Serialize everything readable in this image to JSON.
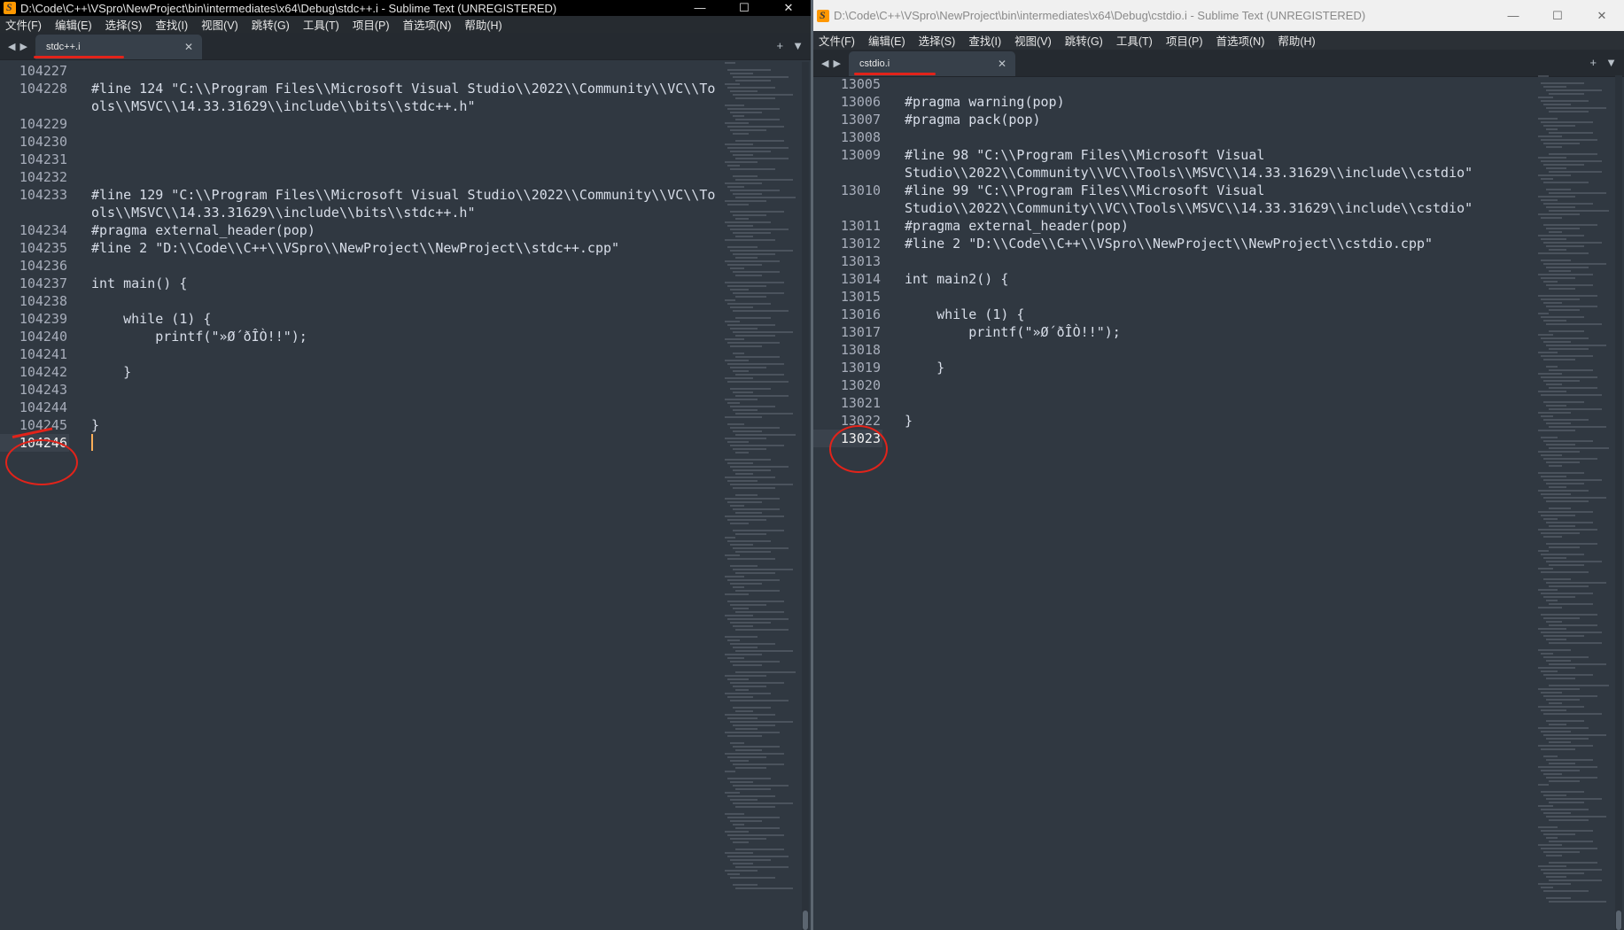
{
  "left": {
    "title": "D:\\Code\\C++\\VSpro\\NewProject\\bin\\intermediates\\x64\\Debug\\stdc++.i - Sublime Text (UNREGISTERED)",
    "menu": [
      "文件(F)",
      "编辑(E)",
      "选择(S)",
      "查找(I)",
      "视图(V)",
      "跳转(G)",
      "工具(T)",
      "项目(P)",
      "首选项(N)",
      "帮助(H)"
    ],
    "tab_label": "stdc++.i",
    "lines": [
      {
        "n": "104227",
        "t": "",
        "tall": false
      },
      {
        "n": "104228",
        "t": "#line 124 \"C:\\\\Program Files\\\\Microsoft Visual Studio\\\\2022\\\\Community\\\\VC\\\\To\nols\\\\MSVC\\\\14.33.31629\\\\include\\\\bits\\\\stdc++.h\"",
        "tall": true
      },
      {
        "n": "104229",
        "t": "",
        "tall": false
      },
      {
        "n": "104230",
        "t": "",
        "tall": false
      },
      {
        "n": "104231",
        "t": "",
        "tall": false
      },
      {
        "n": "104232",
        "t": "",
        "tall": false
      },
      {
        "n": "104233",
        "t": "#line 129 \"C:\\\\Program Files\\\\Microsoft Visual Studio\\\\2022\\\\Community\\\\VC\\\\To\nols\\\\MSVC\\\\14.33.31629\\\\include\\\\bits\\\\stdc++.h\"",
        "tall": true
      },
      {
        "n": "104234",
        "t": "#pragma external_header(pop)",
        "tall": false
      },
      {
        "n": "104235",
        "t": "#line 2 \"D:\\\\Code\\\\C++\\\\VSpro\\\\NewProject\\\\NewProject\\\\stdc++.cpp\"",
        "tall": false
      },
      {
        "n": "104236",
        "t": "",
        "tall": false
      },
      {
        "n": "104237",
        "t": "int main() {",
        "tall": false
      },
      {
        "n": "104238",
        "t": "",
        "tall": false
      },
      {
        "n": "104239",
        "t": "    while (1) {",
        "tall": false
      },
      {
        "n": "104240",
        "t": "        printf(\"»Ø´ðÎÒ!!\");",
        "tall": false
      },
      {
        "n": "104241",
        "t": "",
        "tall": false
      },
      {
        "n": "104242",
        "t": "    }",
        "tall": false
      },
      {
        "n": "104243",
        "t": "",
        "tall": false
      },
      {
        "n": "104244",
        "t": "",
        "tall": false
      },
      {
        "n": "104245",
        "t": "}",
        "tall": false
      },
      {
        "n": "104246",
        "t": "",
        "tall": false
      }
    ]
  },
  "right": {
    "title": "D:\\Code\\C++\\VSpro\\NewProject\\bin\\intermediates\\x64\\Debug\\cstdio.i - Sublime Text (UNREGISTERED)",
    "menu": [
      "文件(F)",
      "编辑(E)",
      "选择(S)",
      "查找(I)",
      "视图(V)",
      "跳转(G)",
      "工具(T)",
      "项目(P)",
      "首选项(N)",
      "帮助(H)"
    ],
    "tab_label": "cstdio.i",
    "lines": [
      {
        "n": "13005",
        "t": "",
        "tall": false
      },
      {
        "n": "13006",
        "t": "#pragma warning(pop)",
        "tall": false
      },
      {
        "n": "13007",
        "t": "#pragma pack(pop)",
        "tall": false
      },
      {
        "n": "13008",
        "t": "",
        "tall": false
      },
      {
        "n": "13009",
        "t": "#line 98 \"C:\\\\Program Files\\\\Microsoft Visual\nStudio\\\\2022\\\\Community\\\\VC\\\\Tools\\\\MSVC\\\\14.33.31629\\\\include\\\\cstdio\"",
        "tall": true
      },
      {
        "n": "13010",
        "t": "#line 99 \"C:\\\\Program Files\\\\Microsoft Visual\nStudio\\\\2022\\\\Community\\\\VC\\\\Tools\\\\MSVC\\\\14.33.31629\\\\include\\\\cstdio\"",
        "tall": true
      },
      {
        "n": "13011",
        "t": "#pragma external_header(pop)",
        "tall": false
      },
      {
        "n": "13012",
        "t": "#line 2 \"D:\\\\Code\\\\C++\\\\VSpro\\\\NewProject\\\\NewProject\\\\cstdio.cpp\"",
        "tall": false
      },
      {
        "n": "13013",
        "t": "",
        "tall": false
      },
      {
        "n": "13014",
        "t": "int main2() {",
        "tall": false
      },
      {
        "n": "13015",
        "t": "",
        "tall": false
      },
      {
        "n": "13016",
        "t": "    while (1) {",
        "tall": false
      },
      {
        "n": "13017",
        "t": "        printf(\"»Ø´ðÎÒ!!\");",
        "tall": false
      },
      {
        "n": "13018",
        "t": "",
        "tall": false
      },
      {
        "n": "13019",
        "t": "    }",
        "tall": false
      },
      {
        "n": "13020",
        "t": "",
        "tall": false
      },
      {
        "n": "13021",
        "t": "",
        "tall": false
      },
      {
        "n": "13022",
        "t": "}",
        "tall": false
      },
      {
        "n": "13023",
        "t": "",
        "tall": false
      }
    ]
  },
  "icons": {
    "app": "sublime-text-icon",
    "minimize": "minimize-icon",
    "maximize": "maximize-icon",
    "close": "close-icon",
    "tab_close": "tab-close-icon",
    "nav_back": "nav-back-icon",
    "nav_forward": "nav-forward-icon",
    "new_tab": "plus-icon",
    "tab_menu": "chevron-down-icon"
  },
  "colors": {
    "editor_bg": "#303841",
    "annotation": "#e2231a",
    "cursor": "#f9ae58"
  }
}
